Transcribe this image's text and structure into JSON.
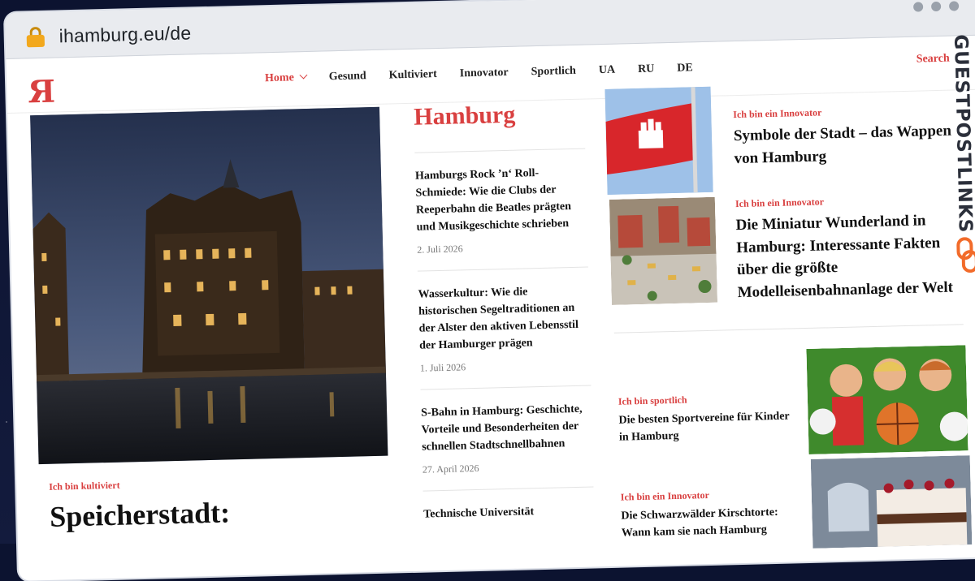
{
  "browser": {
    "url": "ihamburg.eu/de",
    "lock_icon": "lock-icon"
  },
  "nav": {
    "logo": "Я",
    "items": [
      {
        "label": "Home",
        "active": true
      },
      {
        "label": "Gesund"
      },
      {
        "label": "Kultiviert"
      },
      {
        "label": "Innovator"
      },
      {
        "label": "Sportlich"
      },
      {
        "label": "UA"
      },
      {
        "label": "RU"
      },
      {
        "label": "DE"
      }
    ],
    "search_label": "Search"
  },
  "hero": {
    "category": "Ich bin kultiviert",
    "title": "Speicherstadt:"
  },
  "hamburg_column": {
    "heading": "Hamburg",
    "articles": [
      {
        "title": "Hamburgs Rock ’n‘ Roll-Schmiede: Wie die Clubs der Reeperbahn die Beatles prägten und Musikgeschichte schrieben",
        "date": "2. Juli 2026"
      },
      {
        "title": "Wasserkultur: Wie die historischen Segeltraditionen an der Alster den aktiven Lebensstil der Hamburger prägen",
        "date": "1. Juli 2026"
      },
      {
        "title": "S-Bahn in Hamburg: Geschichte, Vorteile und Besonderheiten der schnellen Stadtschnellbahnen",
        "date": "27. April 2026"
      },
      {
        "title": "Technische Universität",
        "date": ""
      }
    ]
  },
  "right_articles": [
    {
      "category": "Ich bin ein Innovator",
      "title": "Symbole der Stadt – das Wappen von Hamburg"
    },
    {
      "category": "Ich bin ein Innovator",
      "title": "Die Miniatur Wunderland in Hamburg: Interessante Fakten über die größte Modelleisenbahnanlage der Welt"
    }
  ],
  "side_articles": [
    {
      "category": "Ich bin sportlich",
      "title": "Die besten Sportvereine für Kinder in Hamburg"
    },
    {
      "category": "Ich bin ein Innovator",
      "title": "Die Schwarzwälder Kirschtorte: Wann kam sie nach Hamburg"
    }
  ],
  "watermark": {
    "text": "GUESTPOSTLINKS",
    "icon": "link-chain-icon"
  }
}
